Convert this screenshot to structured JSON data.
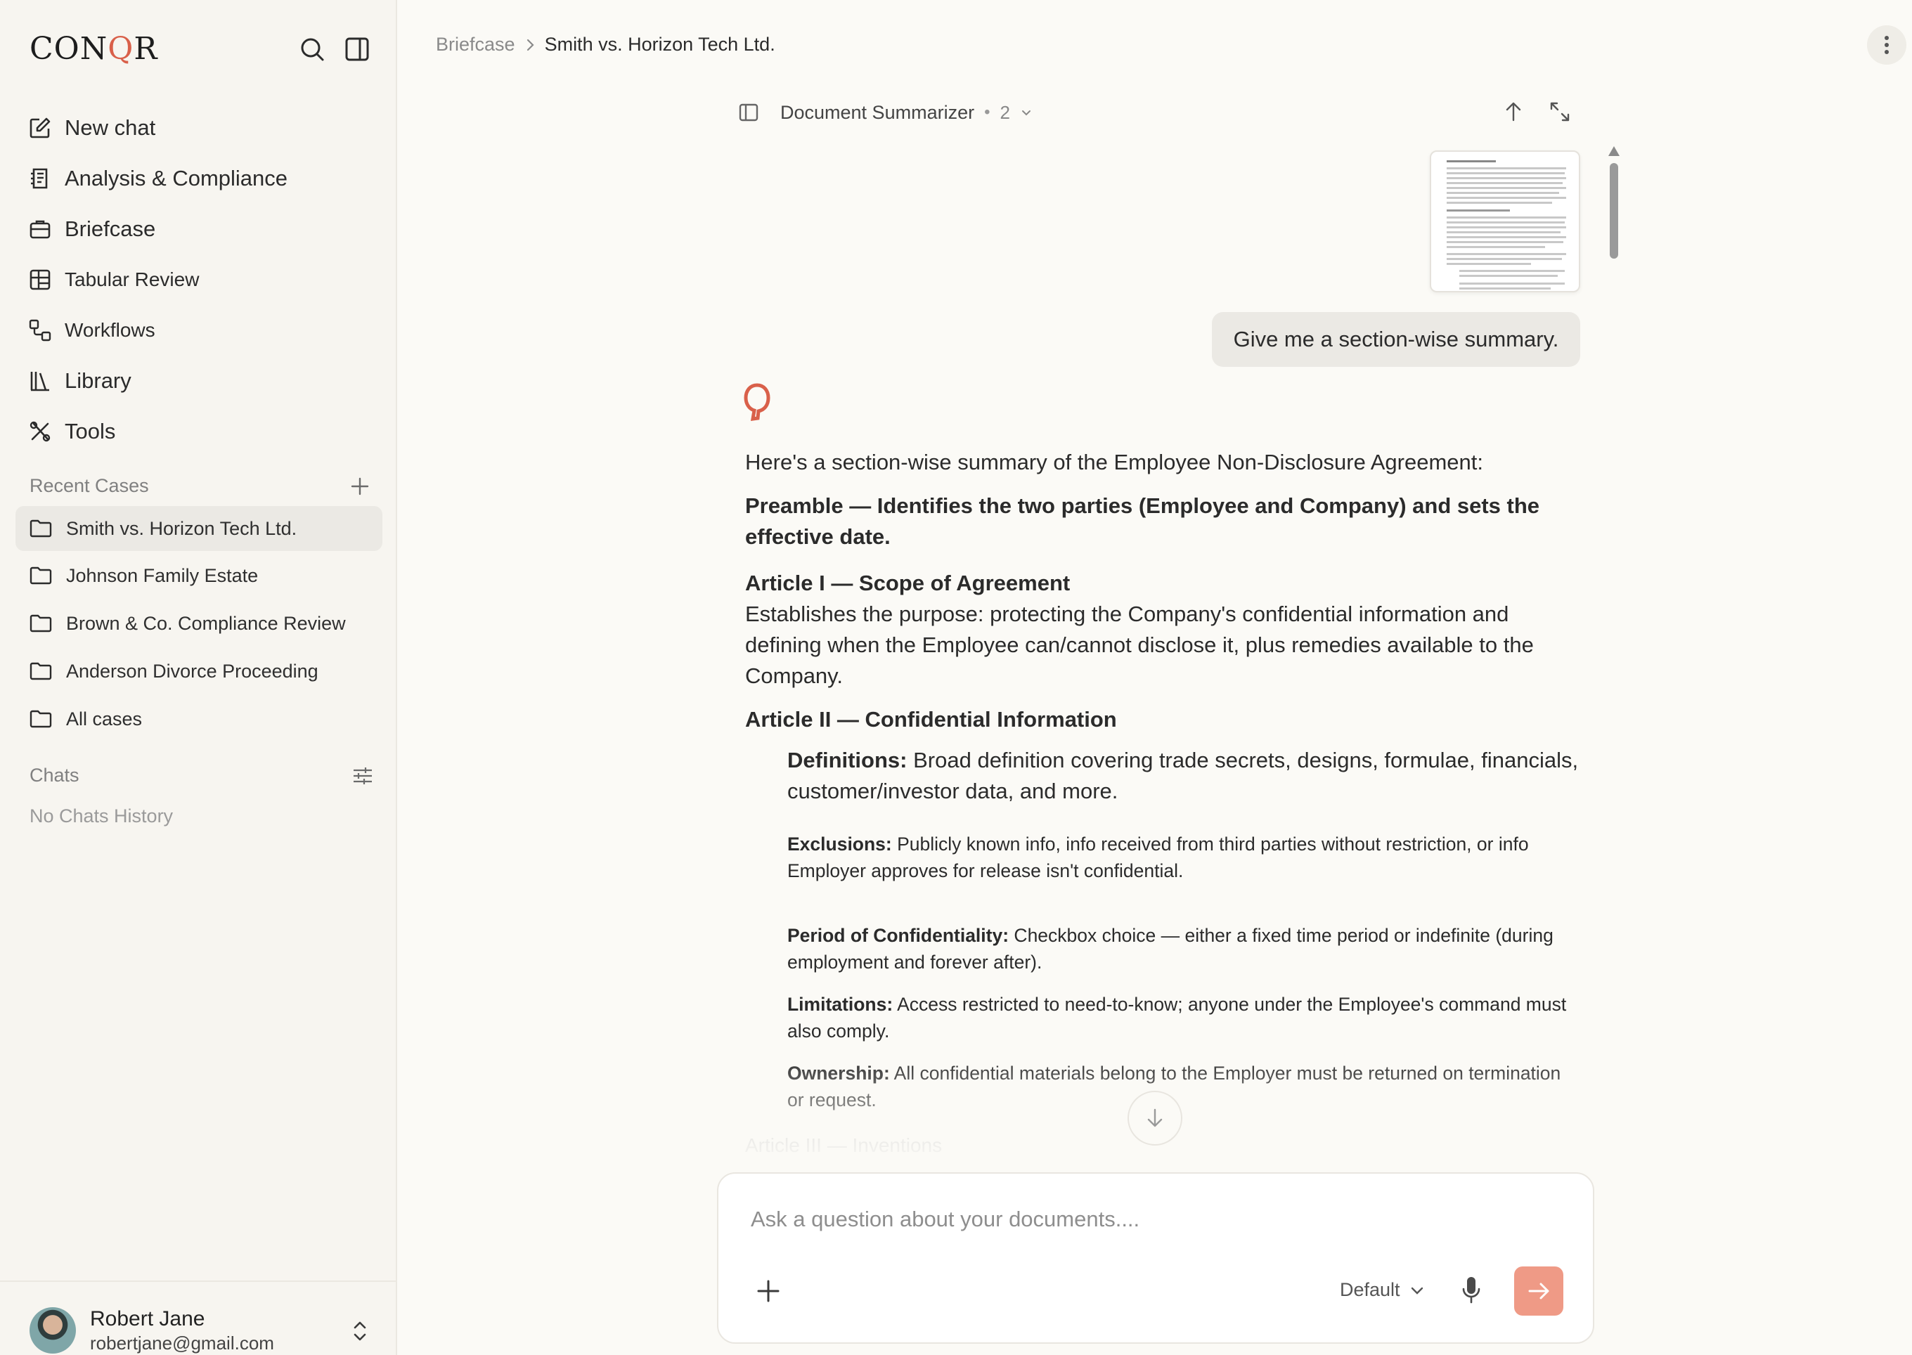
{
  "brand": {
    "logo_pre": "CON",
    "logo_accent": "Q",
    "logo_post": "R",
    "accent_color": "#d9604a"
  },
  "sidebar": {
    "nav": [
      {
        "label": "New chat",
        "icon": "edit-icon"
      },
      {
        "label": "Analysis & Compliance",
        "icon": "document-list-icon"
      },
      {
        "label": "Briefcase",
        "icon": "briefcase-icon"
      },
      {
        "label": "Tabular Review",
        "icon": "table-icon"
      },
      {
        "label": "Workflows",
        "icon": "workflow-icon"
      },
      {
        "label": "Library",
        "icon": "library-icon"
      },
      {
        "label": "Tools",
        "icon": "tools-icon"
      }
    ],
    "recent_cases_label": "Recent Cases",
    "cases": [
      {
        "label": "Smith vs. Horizon Tech Ltd.",
        "active": true
      },
      {
        "label": "Johnson Family Estate"
      },
      {
        "label": "Brown & Co. Compliance Review"
      },
      {
        "label": "Anderson Divorce Proceeding"
      },
      {
        "label": "All cases"
      }
    ],
    "chats_label": "Chats",
    "no_chats": "No Chats History"
  },
  "user": {
    "name": "Robert Jane",
    "email": "robertjane@gmail.com"
  },
  "breadcrumb": {
    "parent": "Briefcase",
    "current": "Smith vs. Horizon Tech Ltd."
  },
  "toolbar": {
    "title": "Document Summarizer",
    "count": "2"
  },
  "conversation": {
    "user_message": "Give me a section-wise summary.",
    "answer": {
      "intro": "Here's a section-wise summary of the Employee Non-Disclosure Agreement:",
      "preamble": "Preamble — Identifies the two parties (Employee and Company) and sets the effective date.",
      "art1_title": "Article I — Scope of Agreement",
      "art1_body": "Establishes the purpose: protecting the Company's confidential information and defining when the Employee can/cannot disclose it, plus remedies available to the Company.",
      "art2_title": "Article II — Confidential Information",
      "definitions_label": "Definitions:",
      "definitions_text": " Broad definition covering trade secrets, designs, formulae, financials, customer/investor data, and more.",
      "exclusions_label": "Exclusions:",
      "exclusions_text": " Publicly known info, info received from third parties without restriction, or info Employer approves for release isn't confidential.",
      "period_label": "Period of Confidentiality:",
      "period_text": " Checkbox choice — either a fixed time period or indefinite (during employment and forever after).",
      "limitations_label": "Limitations:",
      "limitations_text": " Access restricted to need-to-know; anyone under the Employee's command must also comply.",
      "ownership_label": "Ownership:",
      "ownership_text": " All confidential materials belong to the Employer must be returned on termination or request.",
      "art3_title": "Article III — Inventions"
    }
  },
  "composer": {
    "placeholder": "Ask a question about your documents....",
    "model": "Default"
  }
}
